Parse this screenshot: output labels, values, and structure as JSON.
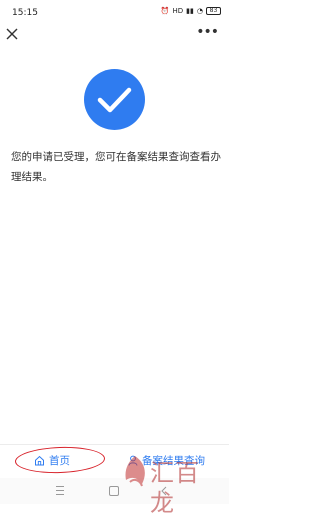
{
  "status_bar": {
    "time": "15:15",
    "network": "HD",
    "battery": "83"
  },
  "icons": {
    "close": "close-icon",
    "more": "more-icon",
    "success": "checkmark-icon",
    "home": "home-icon",
    "user": "person-icon"
  },
  "result": {
    "message": "您的申请已受理，您可在备案结果查询查看办理结果。"
  },
  "bottom_bar": {
    "home_label": "首页",
    "query_label": "备案结果查询"
  },
  "watermark": {
    "text": "汇百龙"
  },
  "colors": {
    "accent": "#2f7cf0",
    "annotation": "#d8222a"
  }
}
